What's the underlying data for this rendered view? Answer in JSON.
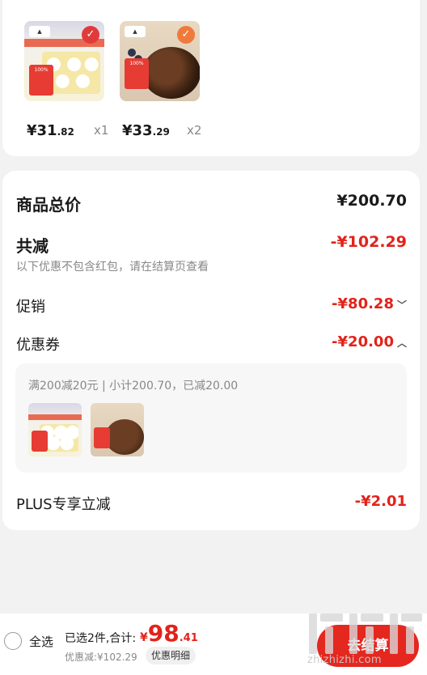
{
  "products": [
    {
      "price_int": "¥31",
      "price_dec": ".82",
      "qty": "x1",
      "label_text": "100%"
    },
    {
      "price_int": "¥33",
      "price_dec": ".29",
      "qty": "x2",
      "label_text": "100%"
    }
  ],
  "summary": {
    "total_label": "商品总价",
    "total_value": "¥200.70",
    "discount_label": "共减",
    "discount_value": "-¥102.29",
    "discount_note": "以下优惠不包含红包，请在结算页查看",
    "promo_label": "促销",
    "promo_value": "-¥80.28",
    "coupon_label": "优惠券",
    "coupon_value": "-¥20.00",
    "coupon_detail": "满200减20元 | 小计200.70，已减20.00",
    "plus_label": "PLUS专享立减",
    "plus_value": "-¥2.01"
  },
  "bottom_bar": {
    "select_all": "全选",
    "selected_info": "已选2件,合计:",
    "total_yen": "¥",
    "total_int": "98",
    "total_dec": ".41",
    "discount_text": "优惠减:¥102.29",
    "detail_button": "优惠明细",
    "checkout_button": "去结算"
  },
  "watermark": {
    "main": "值得买",
    "sub": "zhizhizhi.com"
  },
  "colors": {
    "accent_red": "#e2231a",
    "button_red": "#e4271f",
    "bg": "#f2f2f2"
  }
}
